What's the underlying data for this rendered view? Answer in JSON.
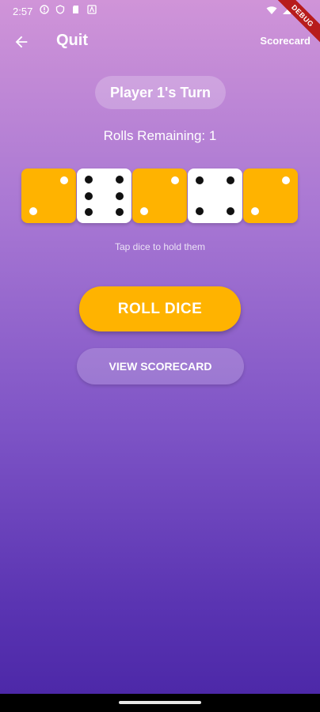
{
  "status_bar": {
    "time": "2:57",
    "left_icons": [
      "alert-circle-icon",
      "shield-icon",
      "sd-card-icon",
      "notification-a-icon"
    ],
    "right_icons": [
      "wifi-icon",
      "signal-icon",
      "battery-icon"
    ]
  },
  "debug_banner": {
    "label": "DEBUG",
    "color": "#b71c1c"
  },
  "app_bar": {
    "back_icon": "arrow-left-icon",
    "title": "Quit",
    "action_label": "Scorecard"
  },
  "game": {
    "turn_label": "Player 1's Turn",
    "rolls_remaining": "Rolls Remaining: 1",
    "hint": "Tap dice to hold them",
    "dice": [
      {
        "value": 2,
        "held": false,
        "color": "#ffb300"
      },
      {
        "value": 6,
        "held": true,
        "color": "#ffffff"
      },
      {
        "value": 2,
        "held": false,
        "color": "#ffb300"
      },
      {
        "value": 4,
        "held": true,
        "color": "#ffffff"
      },
      {
        "value": 2,
        "held": false,
        "color": "#ffb300"
      }
    ]
  },
  "buttons": {
    "roll": "ROLL DICE",
    "view_scorecard": "VIEW SCORECARD"
  },
  "colors": {
    "accent": "#ffb300",
    "gradient_top": "#d094d8",
    "gradient_bottom": "#4a26a6"
  }
}
